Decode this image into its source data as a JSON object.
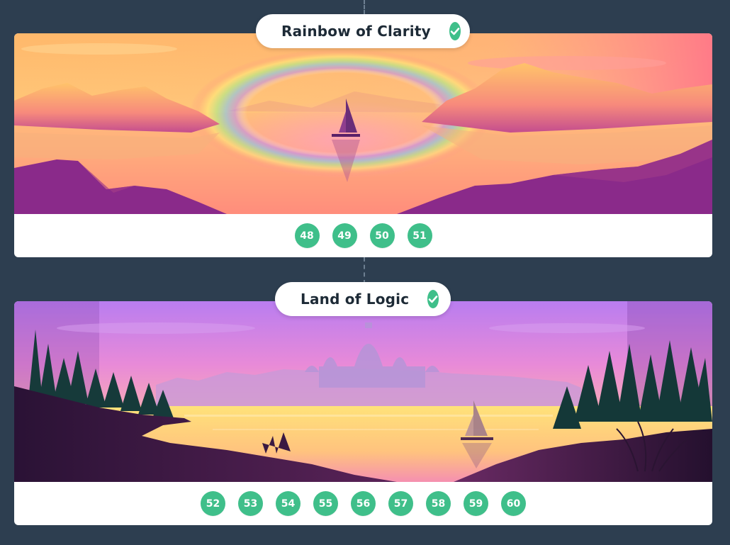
{
  "colors": {
    "page_background": "#2d3e50",
    "badge_green": "#3fbf8a",
    "title_text": "#1d2a36"
  },
  "worlds": [
    {
      "title": "Rainbow of Clarity",
      "completed": true,
      "status_icon": "check-icon",
      "scene": "sunset lake with rainbow and sailboat",
      "levels": [
        "48",
        "49",
        "50",
        "51"
      ]
    },
    {
      "title": "Land of Logic",
      "completed": true,
      "status_icon": "check-icon",
      "scene": "purple dusk lake with domed palace, pine forests and sailboat",
      "levels": [
        "52",
        "53",
        "54",
        "55",
        "56",
        "57",
        "58",
        "59",
        "60"
      ]
    }
  ]
}
